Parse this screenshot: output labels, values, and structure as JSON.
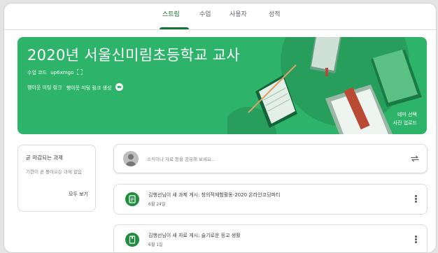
{
  "nav": {
    "tabs": [
      {
        "label": "스트림"
      },
      {
        "label": "수업"
      },
      {
        "label": "사용자"
      },
      {
        "label": "성적"
      }
    ]
  },
  "banner": {
    "title": "2020년 서울신미림초등학교 교사",
    "class_code_label": "수업 코드",
    "class_code": "up6xmgo",
    "meet_link": "행아웃 미팅 링크",
    "meet_create": "행아웃 미팅 링크 생성",
    "theme_select": "테마 선택",
    "upload_photo": "사진 업로드",
    "color": "#2eb46a"
  },
  "upcoming": {
    "title": "곧 마감되는 과제",
    "empty_text": "기한이 곧 돌아오는 과제 없음",
    "view_all": "모두 보기"
  },
  "share_box": {
    "placeholder": "소식이나 자료 등을 공유해 보세요..."
  },
  "stream": [
    {
      "title": "김행선님이 새 과제 게시: 창의적체험활동-2020 온라인코딩파티",
      "date": "6월 24일",
      "icon": "assignment-icon"
    },
    {
      "title": "김행선님이 새 자료 게시: 슬기로운 등교 생활",
      "date": "6월 1일",
      "icon": "material-icon"
    }
  ],
  "colors": {
    "accent": "#137333",
    "stream_icon": "#1e8e3e"
  }
}
